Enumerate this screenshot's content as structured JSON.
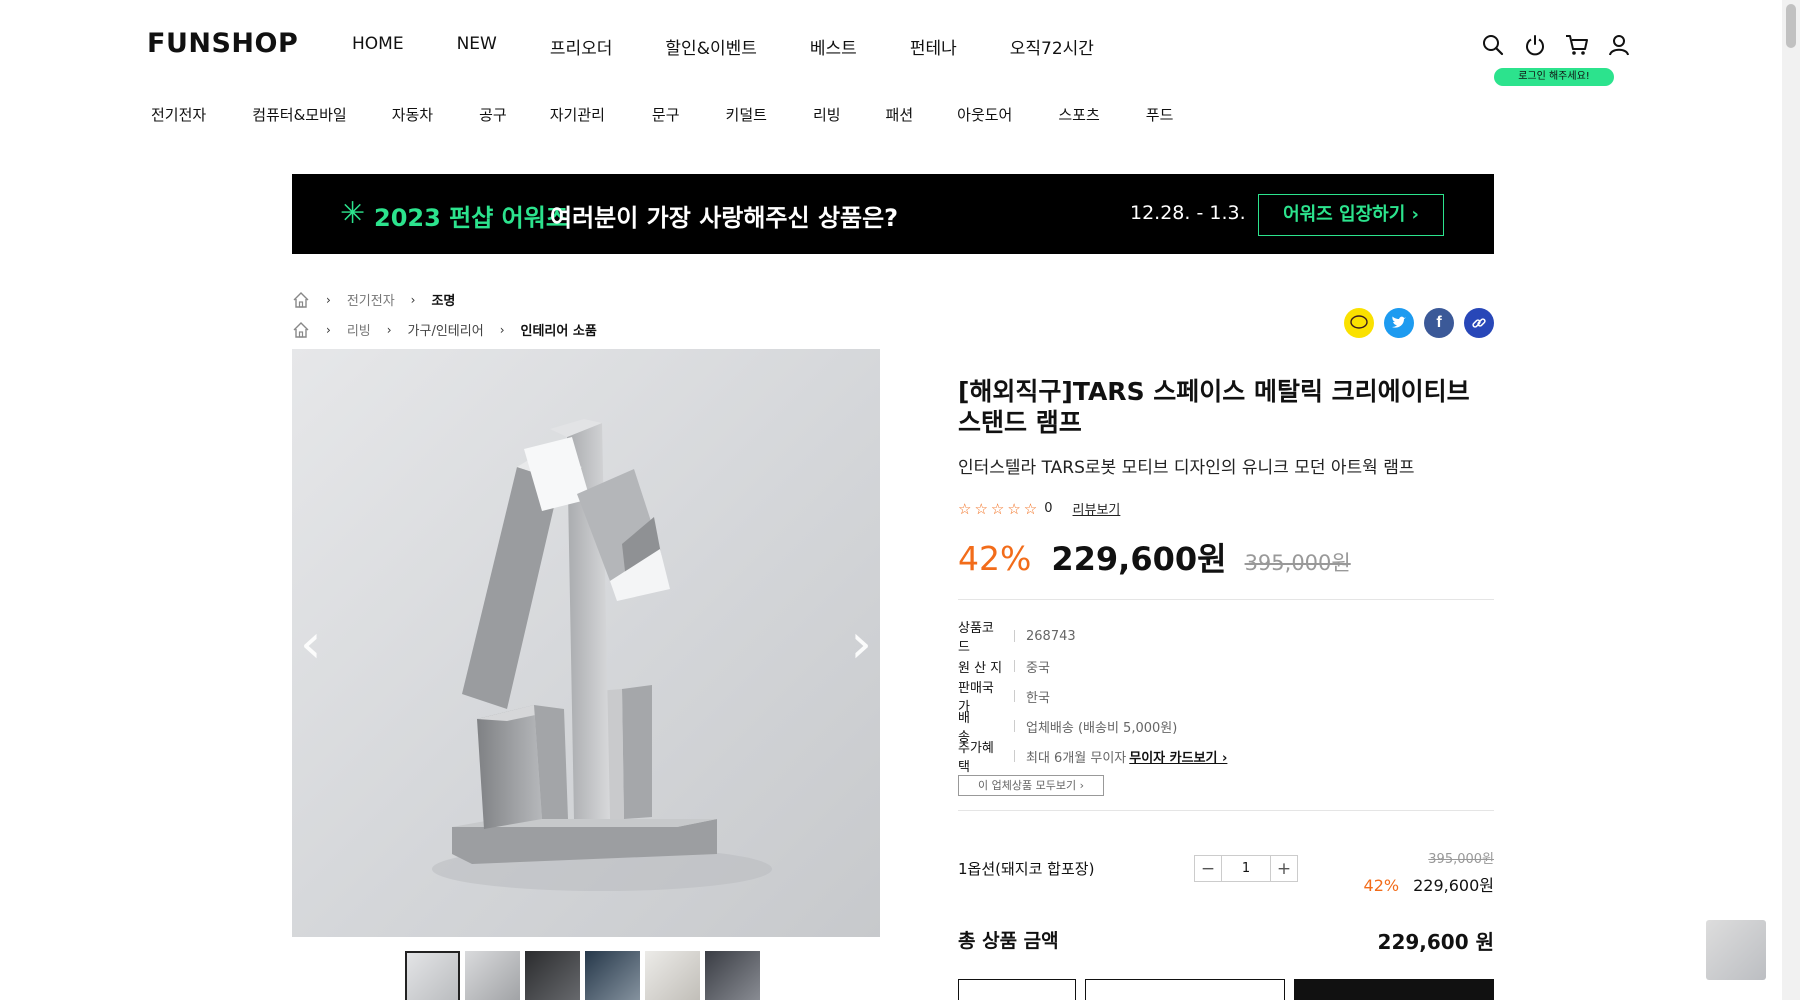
{
  "header": {
    "logo": "FUNSHOP",
    "top_nav": [
      "HOME",
      "NEW",
      "프리오더",
      "할인&이벤트",
      "베스트",
      "펀테나",
      "오직72시간"
    ],
    "icons": [
      "search-icon",
      "power-icon",
      "cart-icon",
      "user-icon"
    ],
    "login_badge": "로그인 해주세요!"
  },
  "categories": [
    "전기전자",
    "컴퓨터&모바일",
    "자동차",
    "공구",
    "자기관리",
    "문구",
    "키덜트",
    "리빙",
    "패션",
    "아웃도어",
    "스포츠",
    "푸드"
  ],
  "banner": {
    "title": "2023 펀샵 어워즈",
    "subtitle": "여러분이 가장 사랑해주신 상품은?",
    "date": "12.28. - 1.3.",
    "button": "어워즈 입장하기 ›",
    "accent": "#2ce38d"
  },
  "breadcrumbs": [
    {
      "items": [
        "전기전자",
        "조명"
      ]
    },
    {
      "items": [
        "리빙",
        "가구/인테리어",
        "인테리어 소품"
      ]
    }
  ],
  "share_icons": [
    "kakaotalk-icon",
    "twitter-icon",
    "facebook-icon",
    "link-icon"
  ],
  "product": {
    "title": "[해외직구]TARS 스페이스 메탈릭 크리에이티브 스탠드 램프",
    "subtitle": "인터스텔라 TARS로봇 모티브 디자인의 유니크 모던 아트웍 램프",
    "rating_count": "0",
    "review_link": "리뷰보기",
    "discount": "42%",
    "price": "229,600원",
    "original_price": "395,000원",
    "discount_color": "#f26c1a",
    "specs": [
      {
        "key": "상품코드",
        "value": "268743"
      },
      {
        "key": "원 산 지",
        "value": "중국"
      },
      {
        "key": "판매국가",
        "value": "한국"
      },
      {
        "key": "배　　송",
        "value": "업체배송 (배송비 5,000원)"
      },
      {
        "key": "추가혜택",
        "value": "최대 6개월 무이자",
        "link": "무이자 카드보기 ›"
      }
    ],
    "vendor_all_button": "이 업체상품 모두보기 ›"
  },
  "option": {
    "name": "1옵션(돼지코 합포장)",
    "quantity": "1",
    "original_price": "395,000원",
    "discount": "42%",
    "price": "229,600원"
  },
  "total": {
    "label": "총 상품 금액",
    "value": "229,600 원"
  }
}
